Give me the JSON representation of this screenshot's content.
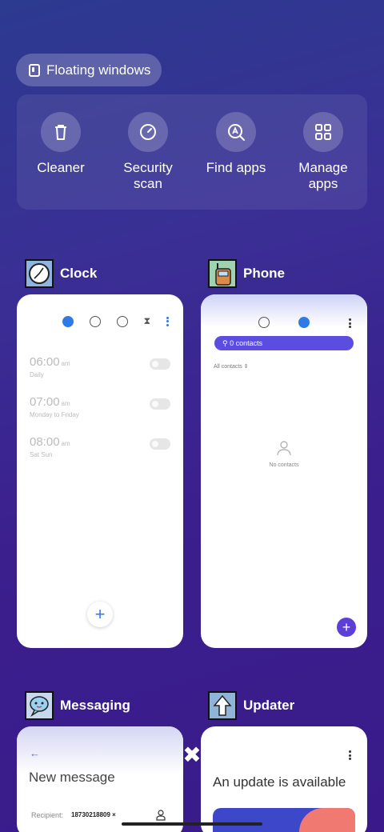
{
  "floating": {
    "label": "Floating windows",
    "icon": "floating-window-icon"
  },
  "tools": [
    {
      "label": "Cleaner",
      "icon": "trash-icon"
    },
    {
      "label": "Security scan",
      "icon": "security-scan-icon"
    },
    {
      "label": "Find apps",
      "icon": "find-apps-icon"
    },
    {
      "label": "Manage apps",
      "icon": "grid-icon"
    }
  ],
  "apps": {
    "clock": {
      "name": "Clock",
      "alarms": [
        {
          "time": "06:00",
          "ampm": "am",
          "repeat": "Daily"
        },
        {
          "time": "07:00",
          "ampm": "am",
          "repeat": "Monday to Friday"
        },
        {
          "time": "08:00",
          "ampm": "am",
          "repeat": "Sat Sun"
        }
      ],
      "fab": "+"
    },
    "phone": {
      "name": "Phone",
      "search": "0 contacts",
      "filter": "All contacts",
      "empty": "No contacts",
      "fab": "+"
    },
    "messaging": {
      "name": "Messaging",
      "back": "←",
      "title": "New message",
      "recipient_label": "Recipient:",
      "recipient_chip": "18730218809 ×"
    },
    "updater": {
      "name": "Updater",
      "title": "An update is available"
    }
  },
  "close": "✖",
  "colors": {
    "accent": "#2f7be6",
    "phone_accent": "#5b4de0",
    "update_blue": "#3c47c9",
    "update_salmon": "#f07a72"
  }
}
